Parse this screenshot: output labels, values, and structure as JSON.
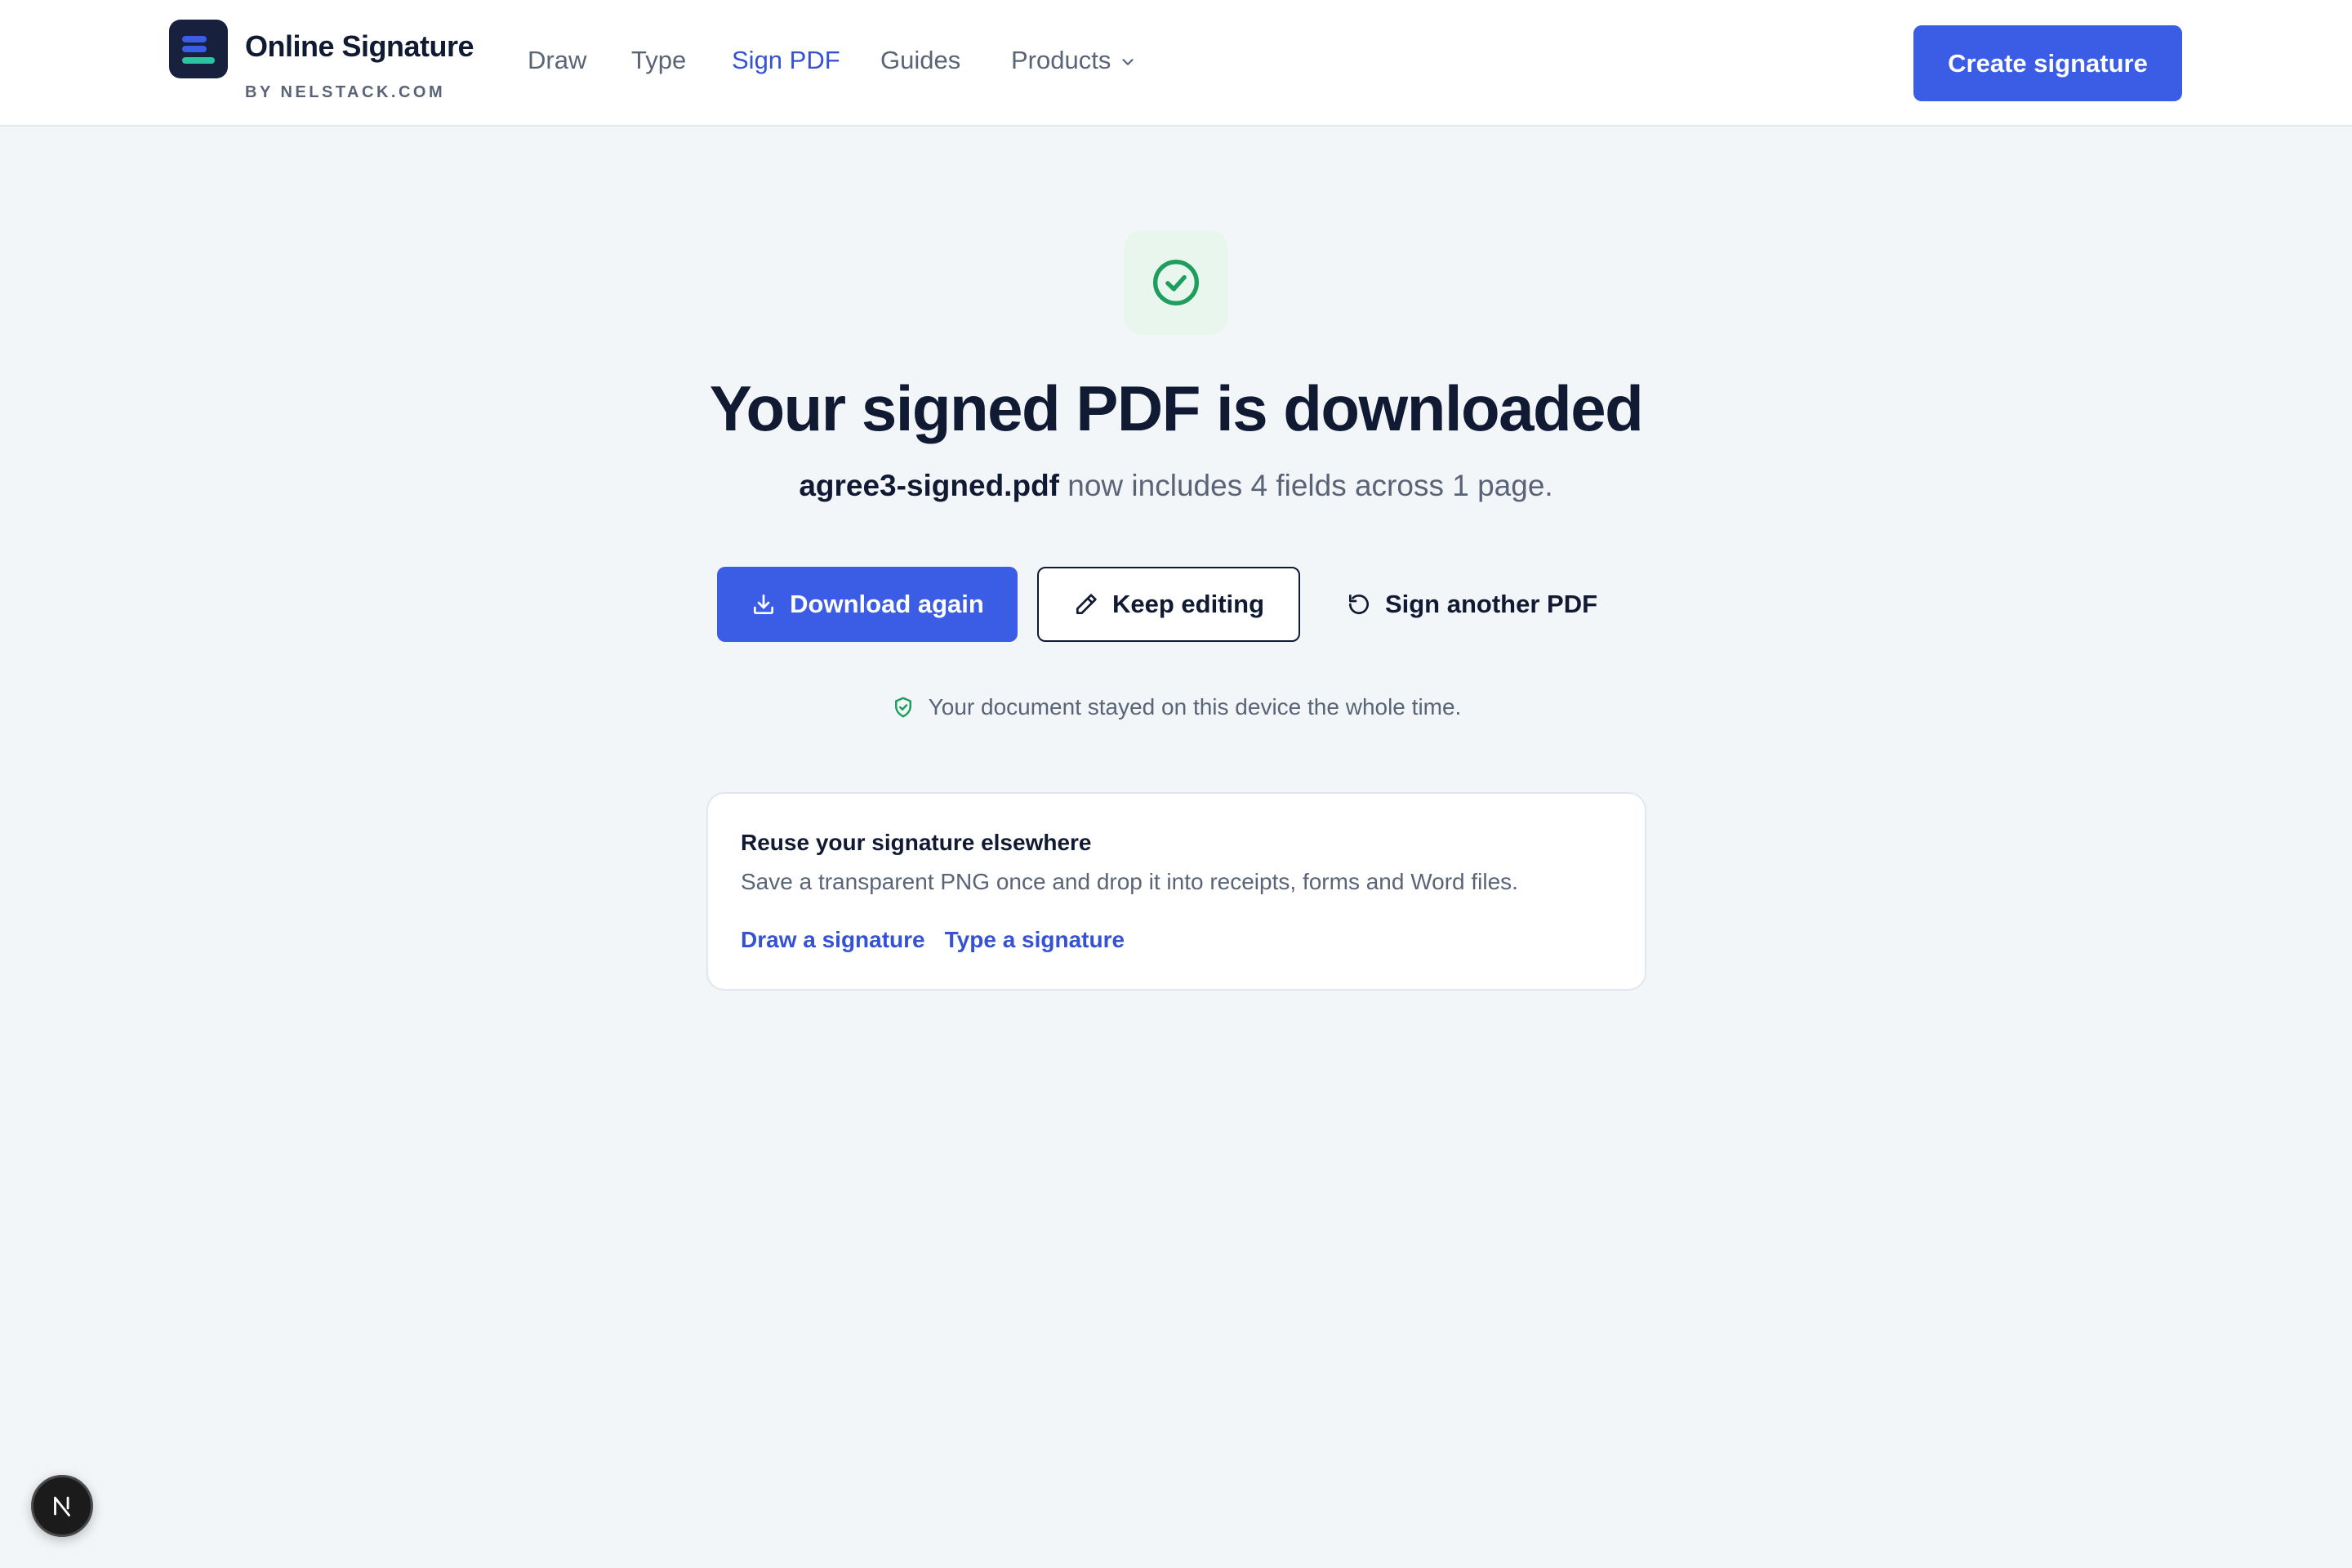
{
  "brand": {
    "title": "Online Signature",
    "subtitle": "BY NELSTACK.COM"
  },
  "nav": {
    "items": [
      {
        "label": "Draw"
      },
      {
        "label": "Type"
      },
      {
        "label": "Sign PDF",
        "active": true
      },
      {
        "label": "Guides"
      },
      {
        "label": "Products",
        "icon": "chevron-down-icon"
      }
    ]
  },
  "header": {
    "cta_label": "Create signature"
  },
  "main": {
    "icon": "check-circle-icon",
    "title": "Your signed PDF is downloaded",
    "filename": "agree3-signed.pdf",
    "subtitle_rest": "now includes 4 fields across 1 page.",
    "actions": {
      "download_label": "Download again",
      "edit_label": "Keep editing",
      "sign_another_label": "Sign another PDF"
    },
    "privacy_note": "Your document stayed on this device the whole time."
  },
  "card": {
    "title": "Reuse your signature elsewhere",
    "description": "Save a transparent PNG once and drop it into receipts, forms and Word files.",
    "links": [
      "Draw a signature",
      "Type a signature"
    ]
  },
  "dev_badge": {
    "letter": "N"
  },
  "colors": {
    "accent": "#3b5ce4",
    "link": "#3552d6",
    "success": "#1e9e5c",
    "background": "#f3f6f9",
    "text": "#111a33",
    "muted": "#5a6477"
  }
}
